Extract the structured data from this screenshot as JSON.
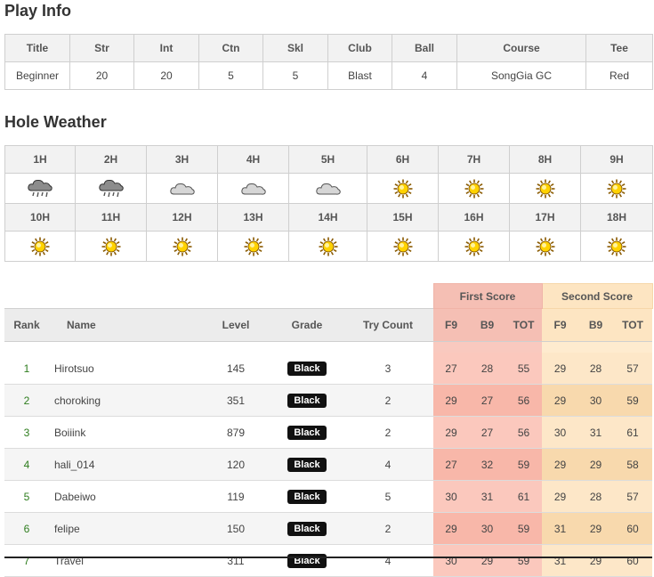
{
  "play_info": {
    "title": "Play Info",
    "headers": [
      "Title",
      "Str",
      "Int",
      "Ctn",
      "Skl",
      "Club",
      "Ball",
      "Course",
      "Tee"
    ],
    "values": [
      "Beginner",
      "20",
      "20",
      "5",
      "5",
      "Blast",
      "4",
      "SongGia GC",
      "Red"
    ]
  },
  "hole_weather": {
    "title": "Hole Weather",
    "holes": [
      {
        "label": "1H",
        "icon": "rain-cloud-icon"
      },
      {
        "label": "2H",
        "icon": "rain-cloud-icon"
      },
      {
        "label": "3H",
        "icon": "cloud-icon"
      },
      {
        "label": "4H",
        "icon": "cloud-icon"
      },
      {
        "label": "5H",
        "icon": "cloud-icon"
      },
      {
        "label": "6H",
        "icon": "sun-icon"
      },
      {
        "label": "7H",
        "icon": "sun-icon"
      },
      {
        "label": "8H",
        "icon": "sun-icon"
      },
      {
        "label": "9H",
        "icon": "sun-icon"
      },
      {
        "label": "10H",
        "icon": "sun-icon"
      },
      {
        "label": "11H",
        "icon": "sun-icon"
      },
      {
        "label": "12H",
        "icon": "sun-icon"
      },
      {
        "label": "13H",
        "icon": "sun-icon"
      },
      {
        "label": "14H",
        "icon": "sun-icon"
      },
      {
        "label": "15H",
        "icon": "sun-icon"
      },
      {
        "label": "16H",
        "icon": "sun-icon"
      },
      {
        "label": "17H",
        "icon": "sun-icon"
      },
      {
        "label": "18H",
        "icon": "sun-icon"
      }
    ]
  },
  "ranking": {
    "first_score_label": "First Score",
    "second_score_label": "Second Score",
    "columns": {
      "rank": "Rank",
      "name": "Name",
      "level": "Level",
      "grade": "Grade",
      "try_count": "Try Count",
      "f9": "F9",
      "b9": "B9",
      "tot": "TOT"
    },
    "rows": [
      {
        "rank": "1",
        "name": "Hirotsuo",
        "level": "145",
        "grade": "Black",
        "try": "3",
        "f": [
          "27",
          "28",
          "55"
        ],
        "s": [
          "29",
          "28",
          "57"
        ]
      },
      {
        "rank": "2",
        "name": "choroking",
        "level": "351",
        "grade": "Black",
        "try": "2",
        "f": [
          "29",
          "27",
          "56"
        ],
        "s": [
          "29",
          "30",
          "59"
        ]
      },
      {
        "rank": "3",
        "name": "Boiiink",
        "level": "879",
        "grade": "Black",
        "try": "2",
        "f": [
          "29",
          "27",
          "56"
        ],
        "s": [
          "30",
          "31",
          "61"
        ]
      },
      {
        "rank": "4",
        "name": "hali_014",
        "level": "120",
        "grade": "Black",
        "try": "4",
        "f": [
          "27",
          "32",
          "59"
        ],
        "s": [
          "29",
          "29",
          "58"
        ]
      },
      {
        "rank": "5",
        "name": "Dabeiwo",
        "level": "119",
        "grade": "Black",
        "try": "5",
        "f": [
          "30",
          "31",
          "61"
        ],
        "s": [
          "29",
          "28",
          "57"
        ]
      },
      {
        "rank": "6",
        "name": "felipe",
        "level": "150",
        "grade": "Black",
        "try": "2",
        "f": [
          "29",
          "30",
          "59"
        ],
        "s": [
          "31",
          "29",
          "60"
        ]
      },
      {
        "rank": "7",
        "name": "Travel",
        "level": "311",
        "grade": "Black",
        "try": "4",
        "f": [
          "30",
          "29",
          "59"
        ],
        "s": [
          "31",
          "29",
          "60"
        ]
      }
    ]
  }
}
